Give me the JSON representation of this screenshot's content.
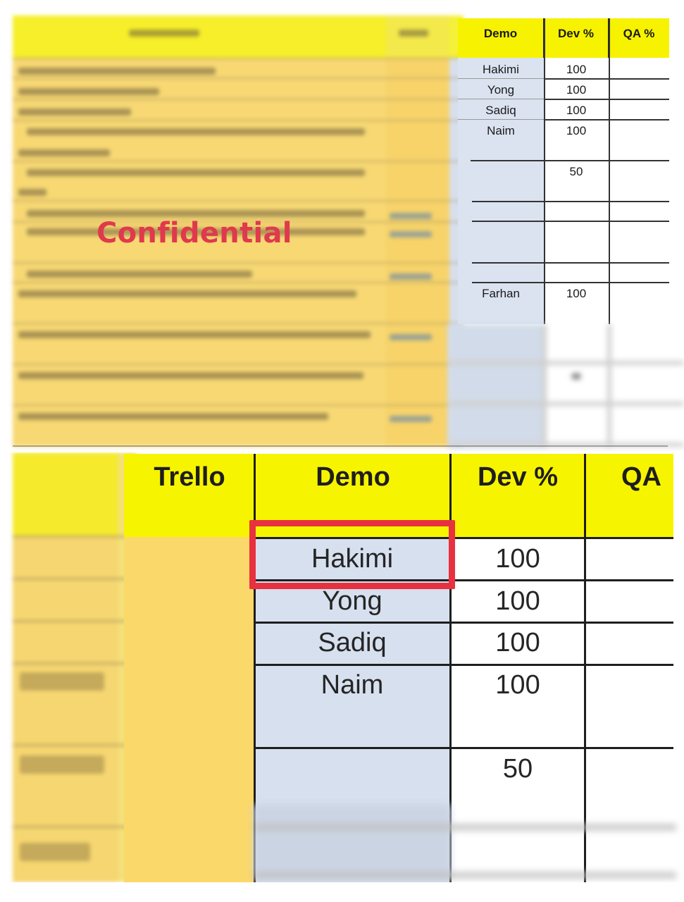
{
  "watermark": {
    "text": "Confidential",
    "color": "#e0394d"
  },
  "top_table": {
    "headers": {
      "demo": "Demo",
      "dev": "Dev %",
      "qa": "QA %"
    },
    "rows": [
      {
        "demo": "Hakimi",
        "dev": "100"
      },
      {
        "demo": "Yong",
        "dev": "100"
      },
      {
        "demo": "Sadiq",
        "dev": "100"
      },
      {
        "demo": "Naim",
        "dev": "100"
      },
      {
        "demo": "",
        "dev": "50"
      },
      {
        "demo": "",
        "dev": ""
      },
      {
        "demo": "",
        "dev": ""
      },
      {
        "demo": "",
        "dev": ""
      },
      {
        "demo": "Farhan",
        "dev": "100"
      }
    ]
  },
  "zoomed_table": {
    "headers": {
      "trello": "Trello",
      "demo": "Demo",
      "dev": "Dev %",
      "qa": "QA"
    },
    "rows": [
      {
        "demo": "Hakimi",
        "dev": "100"
      },
      {
        "demo": "Yong",
        "dev": "100"
      },
      {
        "demo": "Sadiq",
        "dev": "100"
      },
      {
        "demo": "Naim",
        "dev": "100"
      },
      {
        "demo": "",
        "dev": "50"
      }
    ],
    "highlighted_cell": "Hakimi",
    "highlight_color": "#e8313f"
  },
  "colors": {
    "header_yellow": "#f7f400",
    "row_orange": "#fbd86a",
    "demo_blue": "#d7e0ef"
  }
}
